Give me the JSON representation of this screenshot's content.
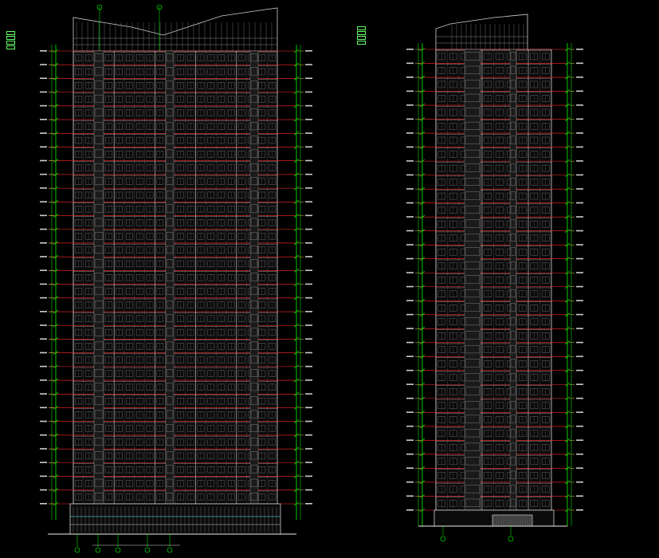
{
  "drawing": {
    "background": "#000000",
    "colors": {
      "floor_line": "#ff2a2a",
      "facade_line": "#d8d8d8",
      "window": "#6a6a6a",
      "green": "#00ff00",
      "yellow": "#ffff55",
      "cyan": "#66ffff",
      "white": "#ffffff"
    },
    "elevations": [
      {
        "name": "front-elevation",
        "floors": 33,
        "window_columns": 20
      },
      {
        "name": "side-elevation",
        "floors": 33,
        "window_columns": 10
      }
    ],
    "legends": [
      {
        "name": "left-legend",
        "rows": [
          "",
          "",
          "",
          ""
        ]
      },
      {
        "name": "right-legend",
        "rows": [
          "",
          "",
          "",
          ""
        ]
      }
    ]
  }
}
